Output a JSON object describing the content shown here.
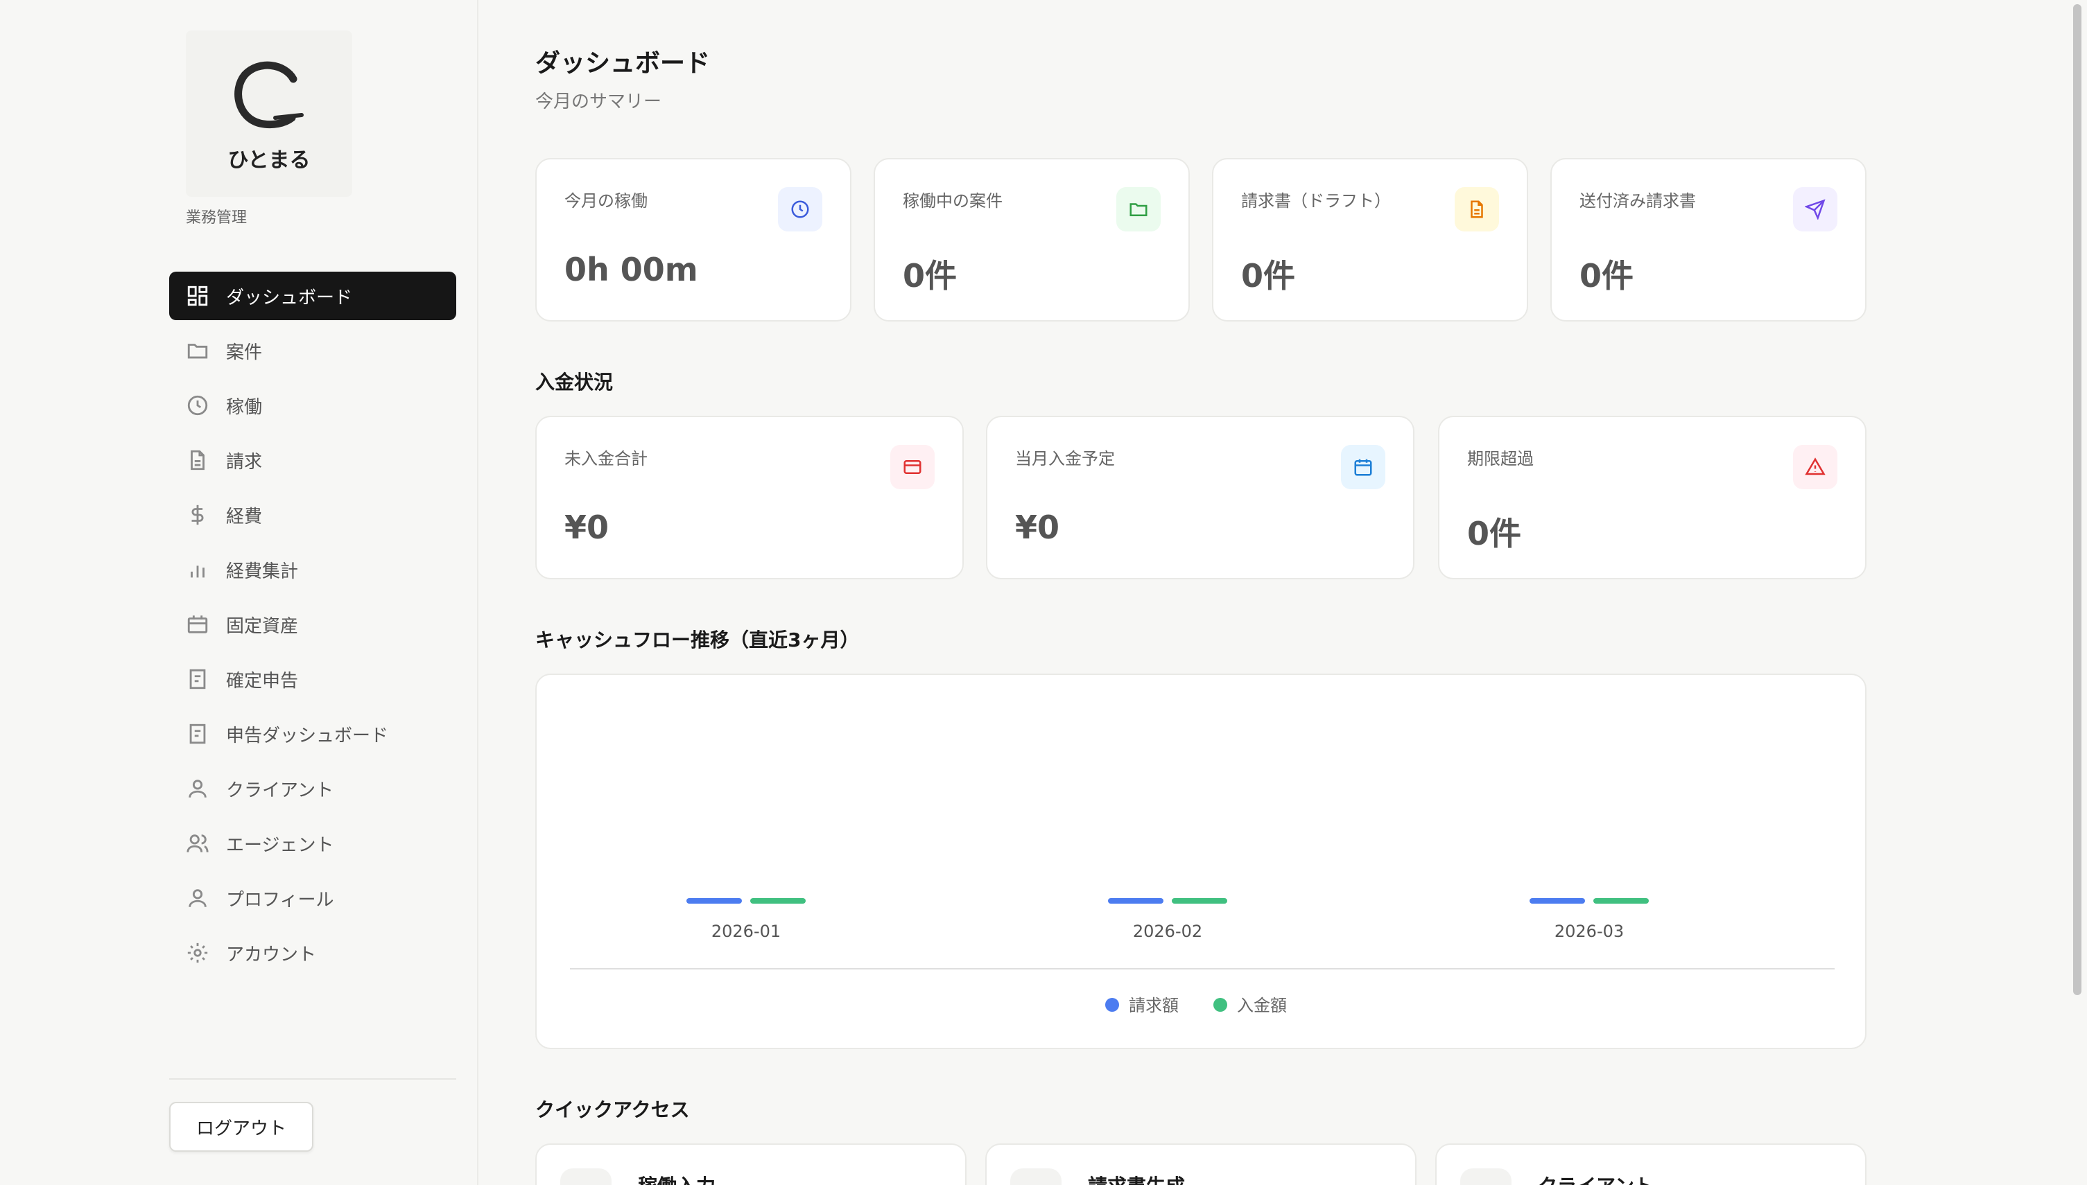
{
  "app": {
    "logo_text": "ひとまる",
    "section_label": "業務管理"
  },
  "sidebar": {
    "items": [
      {
        "label": "ダッシュボード",
        "icon": "dashboard-grid-icon",
        "active": true
      },
      {
        "label": "案件",
        "icon": "folder-icon"
      },
      {
        "label": "稼働",
        "icon": "clock-icon"
      },
      {
        "label": "請求",
        "icon": "document-icon"
      },
      {
        "label": "経費",
        "icon": "dollar-icon"
      },
      {
        "label": "経費集計",
        "icon": "bar-chart-icon"
      },
      {
        "label": "固定資産",
        "icon": "calendar-asset-icon"
      },
      {
        "label": "確定申告",
        "icon": "form-icon"
      },
      {
        "label": "申告ダッシュボード",
        "icon": "form-icon"
      },
      {
        "label": "クライアント",
        "icon": "user-icon"
      },
      {
        "label": "エージェント",
        "icon": "users-icon"
      },
      {
        "label": "プロフィール",
        "icon": "user-icon"
      },
      {
        "label": "アカウント",
        "icon": "gear-icon"
      }
    ],
    "logout_label": "ログアウト"
  },
  "header": {
    "title": "ダッシュボード",
    "subtitle": "今月のサマリー"
  },
  "summary_cards": [
    {
      "label": "今月の稼働",
      "value": "0h 00m",
      "icon": "clock-icon",
      "color": "#3b5bdb",
      "bg": "#edf2ff"
    },
    {
      "label": "稼働中の案件",
      "value": "0件",
      "icon": "folder-icon",
      "color": "#2f9e44",
      "bg": "#ebfbee"
    },
    {
      "label": "請求書（ドラフト）",
      "value": "0件",
      "icon": "document-icon",
      "color": "#e67700",
      "bg": "#fff9db"
    },
    {
      "label": "送付済み請求書",
      "value": "0件",
      "icon": "send-icon",
      "color": "#7048e8",
      "bg": "#f3f0ff"
    }
  ],
  "payment": {
    "title": "入金状況",
    "cards": [
      {
        "label": "未入金合計",
        "value": "¥0",
        "icon": "credit-card-icon",
        "color": "#e03131",
        "bg": "#fff0f3"
      },
      {
        "label": "当月入金予定",
        "value": "¥0",
        "icon": "calendar-icon",
        "color": "#1c7ed6",
        "bg": "#e7f5ff"
      },
      {
        "label": "期限超過",
        "value": "0件",
        "icon": "warning-icon",
        "color": "#e03131",
        "bg": "#fff0f3"
      }
    ]
  },
  "cashflow": {
    "title": "キャッシュフロー推移（直近3ヶ月）"
  },
  "chart_data": {
    "type": "bar",
    "categories": [
      "2026-01",
      "2026-02",
      "2026-03"
    ],
    "series": [
      {
        "name": "請求額",
        "values": [
          0,
          0,
          0
        ],
        "color": "#4c7cf0"
      },
      {
        "name": "入金額",
        "values": [
          0,
          0,
          0
        ],
        "color": "#40c080"
      }
    ],
    "legend": "bottom-center",
    "grid": false
  },
  "quick_access": {
    "title": "クイックアクセス",
    "items": [
      {
        "label": "稼働入力"
      },
      {
        "label": "請求書生成"
      },
      {
        "label": "クライアント"
      }
    ]
  }
}
